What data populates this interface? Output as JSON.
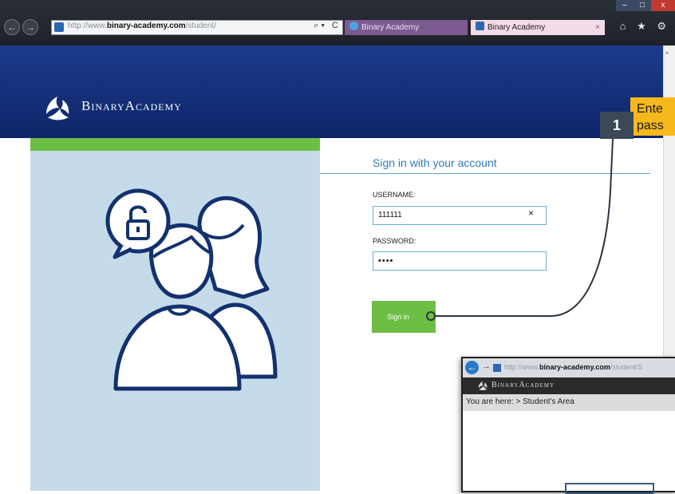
{
  "browser": {
    "url_prefix": "http://www.",
    "url_domain": "binary-academy.com",
    "url_path": "/student/",
    "search_glyph": "⌕ ▾",
    "refresh_glyph": "C",
    "tabs": [
      {
        "label": "Binary Academy"
      },
      {
        "label": "Binary Academy"
      }
    ],
    "tab_close": "×",
    "toolbar_icons": "⌂ ★ ⚙",
    "window_buttons": {
      "minimize": "–",
      "maximize": "□",
      "close": "x"
    }
  },
  "site": {
    "logo_text": "BinaryAcademy"
  },
  "signin": {
    "title": "Sign in with your account",
    "username_label": "USERNAME:",
    "username_value": "111111",
    "clear_glyph": "×",
    "password_label": "PASSWORD:",
    "password_masked": "••••",
    "button_label": "Sign in"
  },
  "annotation": {
    "step_number": "1",
    "callout_text": "Ente\npass"
  },
  "inset": {
    "url_prefix": "http://www.",
    "url_domain": "binary-academy.com",
    "url_path": "/student/S",
    "logo_text": "BinaryAcademy",
    "breadcrumb": "You are here:  > Student's Area"
  },
  "colors": {
    "header_blue": "#1c3c8c",
    "accent_green": "#6dbe45",
    "panel_blue": "#c5dbe9",
    "link_blue": "#2e7bb8",
    "callout_yellow": "#f6b91b",
    "badge_slate": "#3b4855"
  }
}
